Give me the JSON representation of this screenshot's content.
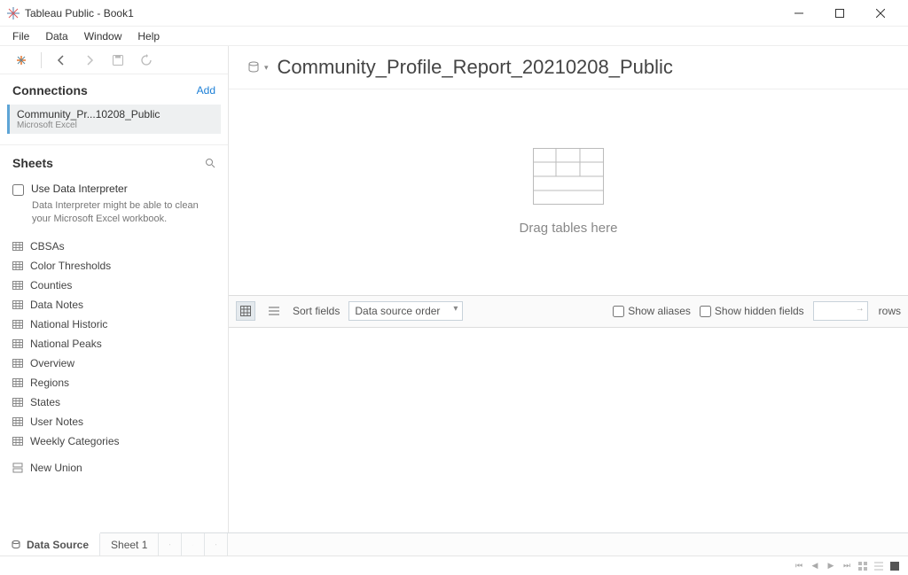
{
  "window": {
    "title": "Tableau Public - Book1"
  },
  "menu": {
    "items": [
      "File",
      "Data",
      "Window",
      "Help"
    ]
  },
  "connections": {
    "header": "Connections",
    "add": "Add",
    "items": [
      {
        "name": "Community_Pr...10208_Public",
        "type": "Microsoft Excel"
      }
    ]
  },
  "sheets": {
    "header": "Sheets",
    "interpreter_label": "Use Data Interpreter",
    "interpreter_desc": "Data Interpreter might be able to clean your Microsoft Excel workbook.",
    "items": [
      "CBSAs",
      "Color Thresholds",
      "Counties",
      "Data Notes",
      "National Historic",
      "National Peaks",
      "Overview",
      "Regions",
      "States",
      "User Notes",
      "Weekly Categories"
    ],
    "new_union": "New Union"
  },
  "datasource": {
    "title": "Community_Profile_Report_20210208_Public",
    "drop_hint": "Drag tables here"
  },
  "grid": {
    "sort_label": "Sort fields",
    "sort_value": "Data source order",
    "show_aliases": "Show aliases",
    "show_hidden": "Show hidden fields",
    "rows_label": "rows",
    "rows_value": ""
  },
  "bottom": {
    "datasource_tab": "Data Source",
    "sheet_tab": "Sheet 1"
  }
}
